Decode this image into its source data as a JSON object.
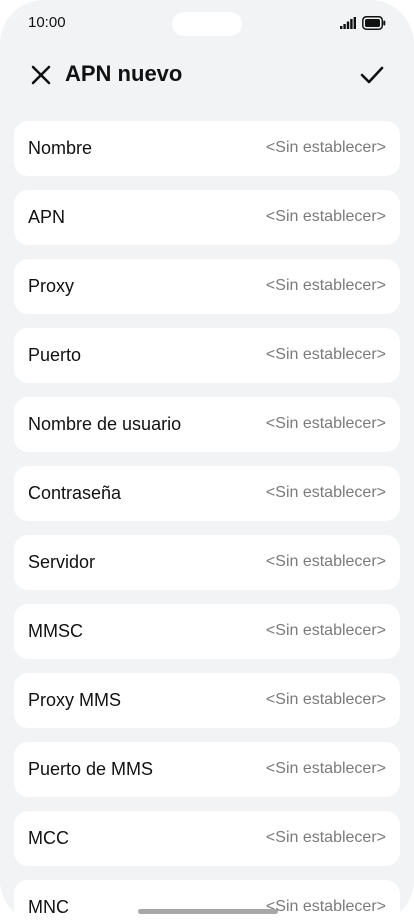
{
  "status": {
    "time": "10:00",
    "signal_icon": "signal-icon",
    "battery_icon": "battery-icon"
  },
  "header": {
    "title": "APN nuevo",
    "close_icon": "close-icon",
    "confirm_icon": "check-icon"
  },
  "fields": [
    {
      "label": "Nombre",
      "value": "<Sin establecer>"
    },
    {
      "label": "APN",
      "value": "<Sin establecer>"
    },
    {
      "label": "Proxy",
      "value": "<Sin establecer>"
    },
    {
      "label": "Puerto",
      "value": "<Sin establecer>"
    },
    {
      "label": "Nombre de usuario",
      "value": "<Sin establecer>"
    },
    {
      "label": "Contraseña",
      "value": "<Sin establecer>"
    },
    {
      "label": "Servidor",
      "value": "<Sin establecer>"
    },
    {
      "label": "MMSC",
      "value": "<Sin establecer>"
    },
    {
      "label": "Proxy MMS",
      "value": "<Sin establecer>"
    },
    {
      "label": "Puerto de MMS",
      "value": "<Sin establecer>"
    },
    {
      "label": "MCC",
      "value": "<Sin establecer>"
    },
    {
      "label": "MNC",
      "value": "<Sin establecer>"
    }
  ]
}
